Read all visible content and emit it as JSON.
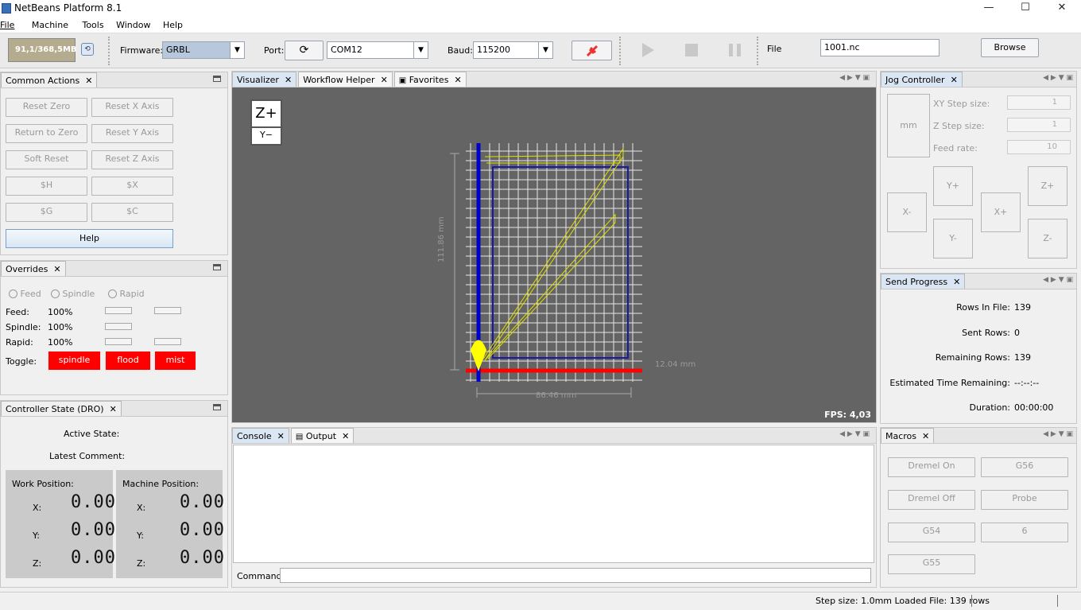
{
  "window": {
    "title": "NetBeans Platform 8.1",
    "minimize": "—",
    "maximize": "☐",
    "close": "✕"
  },
  "menu": [
    "File",
    "Machine",
    "Tools",
    "Window",
    "Help"
  ],
  "toolbar": {
    "memory": "91,1/368,5MB",
    "firmware_label": "Firmware:",
    "firmware_value": "GRBL",
    "port_label": "Port:",
    "port_value": "COM12",
    "baud_label": "Baud:",
    "baud_value": "115200",
    "file_label": "File",
    "file_value": "1001.nc",
    "browse_label": "Browse"
  },
  "common_actions": {
    "title": "Common Actions",
    "buttons": [
      "Reset Zero",
      "Reset X Axis",
      "Return to Zero",
      "Reset Y Axis",
      "Soft Reset",
      "Reset Z Axis",
      "$H",
      "$X",
      "$G",
      "$C"
    ],
    "help": "Help"
  },
  "overrides": {
    "title": "Overrides",
    "radios": [
      "Feed",
      "Spindle",
      "Rapid"
    ],
    "rows": [
      {
        "label": "Feed:",
        "value": "100%"
      },
      {
        "label": "Spindle:",
        "value": "100%"
      },
      {
        "label": "Rapid:",
        "value": "100%"
      }
    ],
    "toggle_label": "Toggle:",
    "toggles": [
      "spindle",
      "flood",
      "mist"
    ]
  },
  "dro": {
    "title": "Controller State (DRO)",
    "active_state": "Active State:",
    "latest_comment": "Latest Comment:",
    "work_title": "Work Position:",
    "machine_title": "Machine Position:",
    "axes": [
      "X:",
      "Y:",
      "Z:"
    ],
    "work": [
      "0.00",
      "0.00",
      "0.00"
    ],
    "machine": [
      "0.00",
      "0.00",
      "0.00"
    ]
  },
  "center_tabs": [
    "Visualizer",
    "Workflow Helper",
    "Favorites"
  ],
  "visualizer": {
    "zplus": "Z+",
    "yminus": "Y−",
    "dim_y": "111.86 mm",
    "dim_x": "86.46 mm",
    "dim_z": "12.04 mm",
    "fps": "FPS: 4,03"
  },
  "bottom_tabs": [
    "Console",
    "Output"
  ],
  "command_label": "Command:",
  "jog": {
    "title": "Jog Controller",
    "unit": "mm",
    "xy_label": "XY Step size:",
    "xy_value": "1",
    "z_label": "Z Step size:",
    "z_value": "1",
    "feed_label": "Feed rate:",
    "feed_value": "10",
    "buttons": {
      "yplus": "Y+",
      "yminus": "Y-",
      "xminus": "X-",
      "xplus": "X+",
      "zplus": "Z+",
      "zminus": "Z-"
    }
  },
  "send_progress": {
    "title": "Send Progress",
    "rows": [
      {
        "label": "Rows In File:",
        "value": "139"
      },
      {
        "label": "Sent Rows:",
        "value": "0"
      },
      {
        "label": "Remaining Rows:",
        "value": "139"
      },
      {
        "label": "Estimated Time Remaining:",
        "value": "--:--:--"
      },
      {
        "label": "Duration:",
        "value": "00:00:00"
      }
    ]
  },
  "macros": {
    "title": "Macros",
    "buttons": [
      "Dremel On",
      "G56",
      "Dremel Off",
      "Probe",
      "G54",
      "6",
      "G55"
    ]
  },
  "status": {
    "text": "Step size: 1.0mm Loaded File: 139 rows"
  },
  "colors": {
    "red": "#ff0000",
    "blue": "#0000cc",
    "yellow": "#ffff00",
    "viz_bg": "#646464"
  }
}
